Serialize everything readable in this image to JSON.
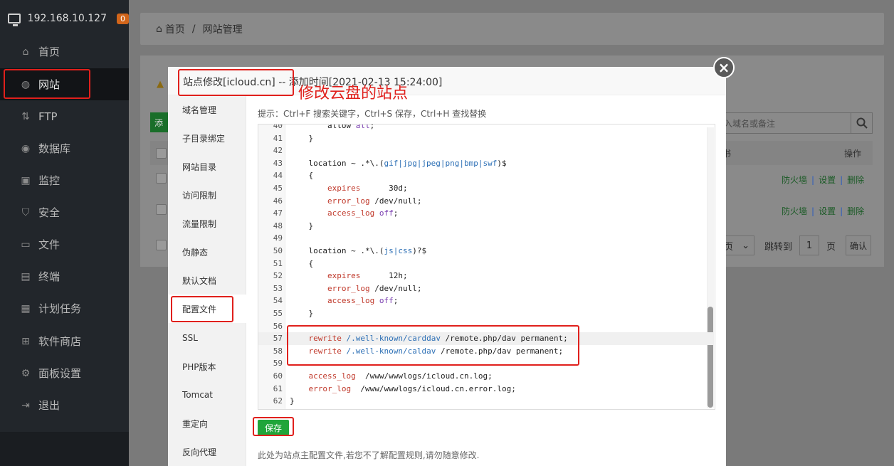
{
  "sidebar": {
    "host": "192.168.10.127",
    "badge": "0",
    "items": [
      {
        "label": "首页",
        "icon": "home-icon"
      },
      {
        "label": "网站",
        "icon": "globe-icon"
      },
      {
        "label": "FTP",
        "icon": "ftp-icon"
      },
      {
        "label": "数据库",
        "icon": "database-icon"
      },
      {
        "label": "监控",
        "icon": "monitor-icon"
      },
      {
        "label": "安全",
        "icon": "shield-icon"
      },
      {
        "label": "文件",
        "icon": "folder-icon"
      },
      {
        "label": "终端",
        "icon": "terminal-icon"
      },
      {
        "label": "计划任务",
        "icon": "calendar-icon"
      },
      {
        "label": "软件商店",
        "icon": "grid-icon"
      },
      {
        "label": "面板设置",
        "icon": "gear-icon"
      },
      {
        "label": "退出",
        "icon": "logout-icon"
      }
    ]
  },
  "breadcrumb": {
    "home": "首页",
    "sep": "/",
    "current": "网站管理"
  },
  "background_page": {
    "add_button": "添",
    "search_placeholder": "入域名或备注",
    "col_mid": "书",
    "col_ops": "操作",
    "rows": [
      {
        "firewall": "防火墙",
        "settings": "设置",
        "delete": "删除",
        "bar": "|"
      },
      {
        "firewall": "防火墙",
        "settings": "设置",
        "delete": "删除",
        "bar": "|"
      }
    ],
    "pager": {
      "unit_suffix": "页",
      "goto": "跳转到",
      "page": "1",
      "page_unit": "页",
      "confirm": "确认"
    }
  },
  "modal": {
    "title": "站点修改[icloud.cn] -- 添加时间[2021-02-13 15:24:00]",
    "tabs": [
      "域名管理",
      "子目录绑定",
      "网站目录",
      "访问限制",
      "流量限制",
      "伪静态",
      "默认文档",
      "配置文件",
      "SSL",
      "PHP版本",
      "Tomcat",
      "重定向",
      "反向代理"
    ],
    "active_tab": "配置文件",
    "hint": "提示：Ctrl+F 搜索关键字，Ctrl+S 保存，Ctrl+H 查找替换",
    "code_lines": [
      {
        "n": "40",
        "t": "        allow all;"
      },
      {
        "n": "41",
        "t": "    }"
      },
      {
        "n": "42",
        "t": ""
      },
      {
        "n": "43",
        "t": "    location ~ .*\\.(gif|jpg|jpeg|png|bmp|swf)$"
      },
      {
        "n": "44",
        "t": "    {"
      },
      {
        "n": "45",
        "t": "        expires      30d;"
      },
      {
        "n": "46",
        "t": "        error_log /dev/null;"
      },
      {
        "n": "47",
        "t": "        access_log off;"
      },
      {
        "n": "48",
        "t": "    }"
      },
      {
        "n": "49",
        "t": ""
      },
      {
        "n": "50",
        "t": "    location ~ .*\\.(js|css)?$"
      },
      {
        "n": "51",
        "t": "    {"
      },
      {
        "n": "52",
        "t": "        expires      12h;"
      },
      {
        "n": "53",
        "t": "        error_log /dev/null;"
      },
      {
        "n": "54",
        "t": "        access_log off;"
      },
      {
        "n": "55",
        "t": "    }"
      },
      {
        "n": "56",
        "t": ""
      },
      {
        "n": "57",
        "t": "    rewrite /.well-known/carddav /remote.php/dav permanent;"
      },
      {
        "n": "58",
        "t": "    rewrite /.well-known/caldav /remote.php/dav permanent;"
      },
      {
        "n": "59",
        "t": ""
      },
      {
        "n": "60",
        "t": "    access_log  /www/wwwlogs/icloud.cn.log;"
      },
      {
        "n": "61",
        "t": "    error_log  /www/wwwlogs/icloud.cn.error.log;"
      },
      {
        "n": "62",
        "t": "}"
      }
    ],
    "save": "保存",
    "note": "此处为站点主配置文件,若您不了解配置规则,请勿随意修改."
  },
  "annotation": "修改云盘的站点",
  "colors": {
    "accent": "#20a53a",
    "highlight": "#e0201c",
    "sidebar": "#22262b"
  }
}
